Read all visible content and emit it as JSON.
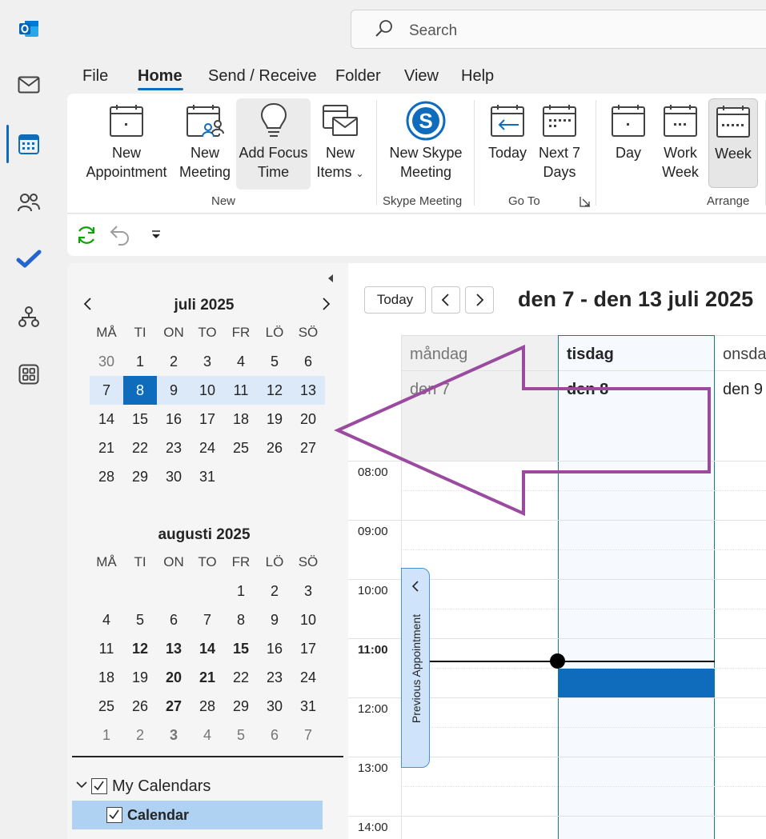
{
  "search": {
    "placeholder": "Search"
  },
  "menu": [
    "File",
    "Home",
    "Send / Receive",
    "Folder",
    "View",
    "Help"
  ],
  "ribbon": {
    "new_appointment": [
      "New",
      "Appointment"
    ],
    "new_meeting": [
      "New",
      "Meeting"
    ],
    "add_focus_time": [
      "Add Focus",
      "Time"
    ],
    "new_items": [
      "New",
      "Items"
    ],
    "group_new": "New",
    "new_skype": [
      "New Skype",
      "Meeting"
    ],
    "group_skype": "Skype Meeting",
    "today": "Today",
    "next7": [
      "Next 7",
      "Days"
    ],
    "group_goto": "Go To",
    "day": "Day",
    "work_week": [
      "Work",
      "Week"
    ],
    "week": "Week",
    "group_arrange": "Arrange"
  },
  "mini_cal_1": {
    "title": "juli 2025",
    "dow": [
      "MÅ",
      "TI",
      "ON",
      "TO",
      "FR",
      "LÖ",
      "SÖ"
    ],
    "weeks": [
      [
        "30",
        "1",
        "2",
        "3",
        "4",
        "5",
        "6"
      ],
      [
        "7",
        "8",
        "9",
        "10",
        "11",
        "12",
        "13"
      ],
      [
        "14",
        "15",
        "16",
        "17",
        "18",
        "19",
        "20"
      ],
      [
        "21",
        "22",
        "23",
        "24",
        "25",
        "26",
        "27"
      ],
      [
        "28",
        "29",
        "30",
        "31",
        "",
        "",
        ""
      ]
    ]
  },
  "mini_cal_2": {
    "title": "augusti 2025",
    "dow": [
      "MÅ",
      "TI",
      "ON",
      "TO",
      "FR",
      "LÖ",
      "SÖ"
    ],
    "weeks": [
      [
        "",
        "",
        "",
        "",
        "1",
        "2",
        "3"
      ],
      [
        "4",
        "5",
        "6",
        "7",
        "8",
        "9",
        "10"
      ],
      [
        "11",
        "12",
        "13",
        "14",
        "15",
        "16",
        "17"
      ],
      [
        "18",
        "19",
        "20",
        "21",
        "22",
        "23",
        "24"
      ],
      [
        "25",
        "26",
        "27",
        "28",
        "29",
        "30",
        "31"
      ],
      [
        "1",
        "2",
        "3",
        "4",
        "5",
        "6",
        "7"
      ]
    ]
  },
  "my_calendars": {
    "label": "My Calendars",
    "calendar": "Calendar"
  },
  "main": {
    "today_btn": "Today",
    "range_title": "den 7 - den 13 juli 2025",
    "days": [
      {
        "name": "måndag",
        "date": "den 7"
      },
      {
        "name": "tisdag",
        "date": "den 8"
      },
      {
        "name": "onsdag",
        "date": "den 9"
      }
    ],
    "hours": [
      "08:00",
      "09:00",
      "10:00",
      "11:00",
      "12:00",
      "13:00",
      "14:00"
    ],
    "prev_appt": "Previous Appointment"
  },
  "colors": {
    "accent": "#0f6cbd",
    "arrow": "#9b4b9f"
  }
}
